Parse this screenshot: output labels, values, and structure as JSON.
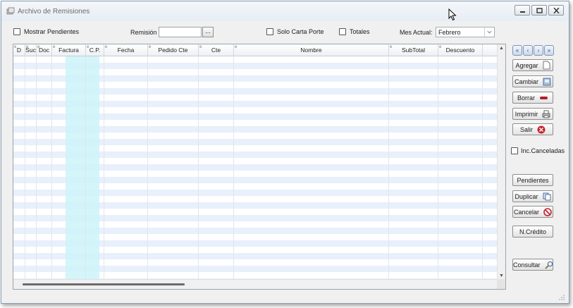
{
  "window": {
    "title": "Archivo de Remisiones"
  },
  "filters": {
    "mostrar_pendientes_label": "Mostrar Pendientes",
    "remision_label": "Remisión",
    "remision_value": "",
    "browse_label": "...",
    "solo_carta_porte_label": "Solo Carta Porte",
    "totales_label": "Totales",
    "mes_actual_label": "Mes Actual:",
    "mes_actual_value": "Febrero"
  },
  "table": {
    "columns": [
      "D",
      "Suc",
      "Doc",
      "Factura",
      "C.P.",
      "Fecha",
      "Pedido Cte",
      "Cte",
      "Nombre",
      "SubTotal",
      "Descuento"
    ],
    "rows": []
  },
  "nav": {
    "first": "«",
    "prev": "‹",
    "next": "›",
    "last": "»"
  },
  "actions": {
    "agregar": "Agregar",
    "cambiar": "Cambiar",
    "borrar": "Borrar",
    "imprimir": "Imprimir",
    "salir": "Salir",
    "inc_canceladas": "Inc.Canceladas",
    "pendientes": "Pendientes",
    "duplicar": "Duplicar",
    "cancelar": "Cancelar",
    "ncredito": "N.Crédito",
    "consultar": "Consultar"
  },
  "colors": {
    "highlight_column": "#cdf3f8",
    "row_stripe": "#e7f0fb",
    "accent": "#2b4d80"
  }
}
